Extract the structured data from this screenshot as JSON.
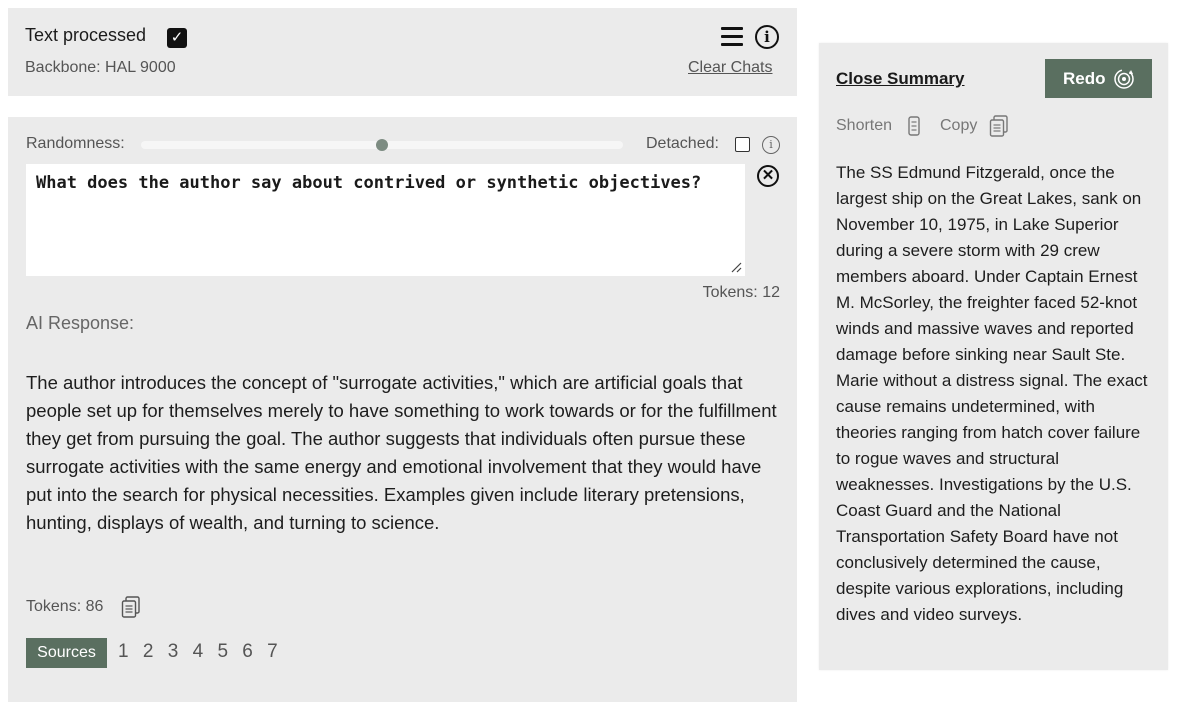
{
  "header": {
    "status_label": "Text processed",
    "processed_checked": true,
    "backbone": "Backbone: HAL 9000",
    "clear_chats_label": "Clear Chats"
  },
  "controls": {
    "randomness_label": "Randomness:",
    "randomness_value": 0.5,
    "detached_label": "Detached:",
    "detached_checked": false
  },
  "query": {
    "text": "What does the author say about contrived or synthetic objectives?",
    "tokens_label": "Tokens: 12"
  },
  "response": {
    "label": "AI Response:",
    "text": "The author introduces the concept of \"surrogate activities,\" which are artificial goals that people set up for themselves merely to have something to work towards or for the fulfillment they get from pursuing the goal. The author suggests that individuals often pursue these surrogate activities with the same energy and emotional involvement that they would have put into the search for physical necessities. Examples given include literary pretensions, hunting, displays of wealth, and turning to science.",
    "tokens_label": "Tokens: 86",
    "sources_label": "Sources",
    "source_links": [
      "1",
      "2",
      "3",
      "4",
      "5",
      "6",
      "7"
    ]
  },
  "summary": {
    "close_label": "Close Summary",
    "redo_label": "Redo",
    "shorten_label": "Shorten",
    "copy_label": "Copy",
    "text": "The SS Edmund Fitzgerald, once the largest ship on the Great Lakes, sank on November 10, 1975, in Lake Superior during a severe storm with 29 crew members aboard. Under Captain Ernest M. McSorley, the freighter faced 52-knot winds and massive waves and reported damage before sinking near Sault Ste. Marie without a distress signal. The exact cause remains undetermined, with theories ranging from hatch cover failure to rogue waves and structural weaknesses. Investigations by the U.S. Coast Guard and the National Transportation Safety Board have not conclusively determined the cause, despite various explorations, including dives and video surveys."
  },
  "icons": {
    "menu": "hamburger-menu-icon",
    "info": "info-icon",
    "clear": "clear-circle-x-icon",
    "copy": "copy-document-icon",
    "shorten": "shorten-icon",
    "redo": "redo-target-icon"
  },
  "colors": {
    "accent": "#5a6f60",
    "panel_bg": "#ebebeb"
  }
}
